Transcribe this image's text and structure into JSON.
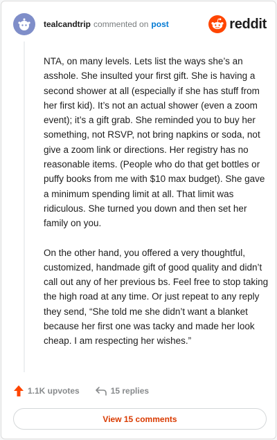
{
  "comment": {
    "username": "tealcandtrip",
    "action_text": "commented on",
    "target_link": "post",
    "brand": "reddit",
    "paragraphs": [
      "NTA, on many levels. Lets list the ways she’s an asshole. She insulted your first gift. She is having a second shower at all (especially if she has stuff from her first kid). It’s not an actual shower (even a zoom event); it’s a gift grab. She reminded you to buy her something, not RSVP, not bring napkins or soda, not give a zoom link or directions. Her registry has no reasonable items. (People who do that get bottles or puffy books from me with $10 max budget). She gave a minimum spending limit at all. That limit was ridiculous. She turned you down and then set her family on you.",
      "On the other hand, you offered a very thoughtful, customized, handmade gift of good quality and didn’t call out any of her previous bs. Feel free to stop taking the high road at any time. Or just repeat to any reply they send, “She told me she didn’t want a blanket because her first one was tacky and made her look cheap. I am respecting her wishes.”"
    ]
  },
  "actions": {
    "upvotes": "1.1K upvotes",
    "replies": "15 replies"
  },
  "view_comments_label": "View 15 comments",
  "colors": {
    "brand_orange": "#ff4500",
    "link_blue": "#0079d3",
    "button_text": "#d93a00",
    "avatar": "#7f8ec9"
  },
  "icons": {
    "avatar": "snoo-avatar-icon",
    "brand": "reddit-logo-icon",
    "upvote": "upvote-arrow-icon",
    "reply": "reply-arrow-icon"
  }
}
